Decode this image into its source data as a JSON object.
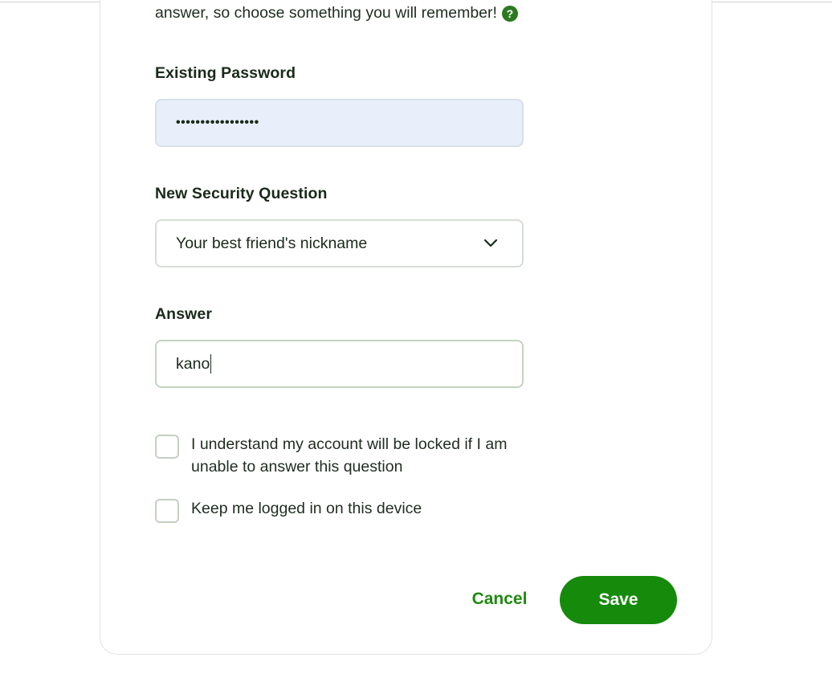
{
  "intro": {
    "text": "answer, so choose something you will remember!",
    "help_icon": "question-circle-icon"
  },
  "existing_password": {
    "label": "Existing Password",
    "value": "•••••••••••••••••"
  },
  "security_question": {
    "label": "New Security Question",
    "selected": "Your best friend's nickname",
    "icon": "chevron-down-icon"
  },
  "answer": {
    "label": "Answer",
    "value": "kano"
  },
  "checkboxes": [
    {
      "label": "I understand my account will be locked if I am unable to answer this question",
      "checked": false
    },
    {
      "label": "Keep me logged in on this device",
      "checked": false
    }
  ],
  "actions": {
    "cancel_label": "Cancel",
    "save_label": "Save"
  },
  "colors": {
    "accent": "#168a0a",
    "link": "#1f8a0f",
    "password_bg": "#e8effb"
  }
}
